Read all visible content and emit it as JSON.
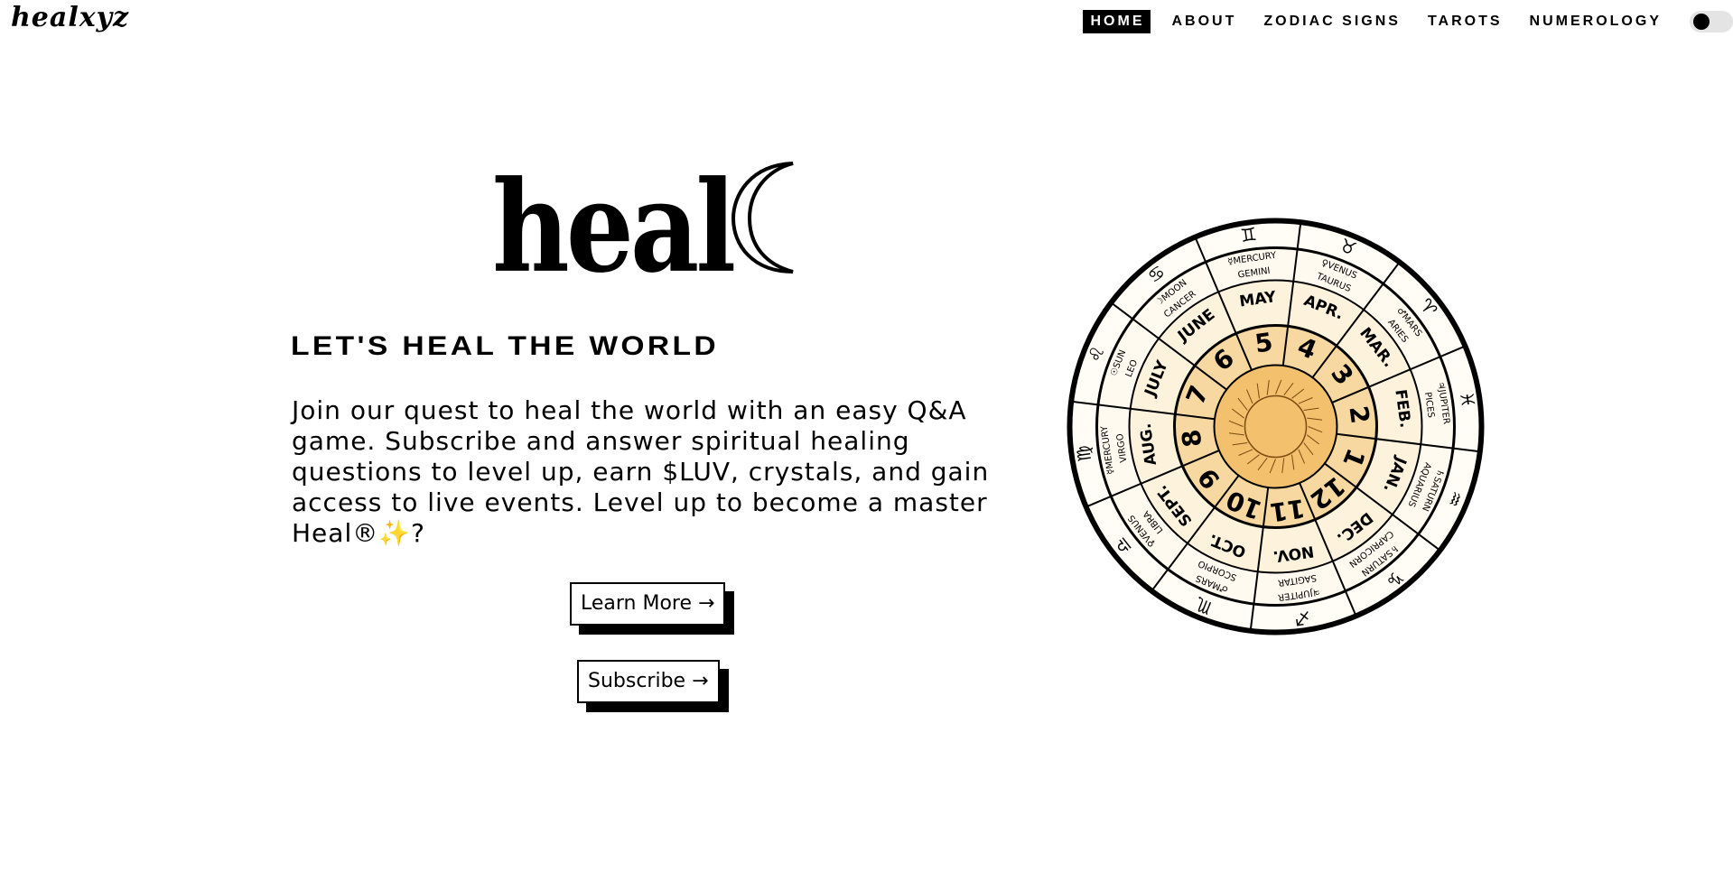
{
  "header": {
    "logo": "healxyz",
    "nav": [
      {
        "label": "HOME",
        "active": true
      },
      {
        "label": "ABOUT",
        "active": false
      },
      {
        "label": "ZODIAC SIGNS",
        "active": false
      },
      {
        "label": "TAROTS",
        "active": false
      },
      {
        "label": "NUMEROLOGY",
        "active": false
      }
    ],
    "theme_toggle": {
      "state": "off"
    }
  },
  "hero": {
    "wordmark": "heal",
    "wordmark_icon": "crescent-moon-icon",
    "tagline": "LET'S HEAL THE WORLD",
    "intro_text": "Join our quest to heal the world with an easy Q&A game. Subscribe and answer spiritual healing questions to level up, earn $LUV, crystals, and gain access to live events. Level up to become a master Heal®",
    "intro_sparkle": "✨",
    "intro_end": "?",
    "buttons": {
      "learn_more": "Learn More →",
      "subscribe": "Subscribe →"
    }
  },
  "zodiac_wheel": {
    "months": [
      "JAN.",
      "FEB.",
      "MAR.",
      "APR.",
      "MAY",
      "JUNE",
      "JULY",
      "AUG.",
      "SEPT.",
      "OCT.",
      "NOV.",
      "DEC."
    ],
    "signs": [
      "AQUARIUS",
      "PICES",
      "ARIES",
      "TAURUS",
      "GEMINI",
      "CANCER",
      "LEO",
      "VIRGO",
      "LIBRA",
      "SCORPIO",
      "SAGITAR",
      "CAPRICORN"
    ],
    "planets": [
      "♄SATURN",
      "♃JUPITER",
      "♂MARS",
      "♀VENUS",
      "☿MERCURY",
      "☽MOON",
      "☉SUN",
      "☿MERCURY",
      "♀VENUS",
      "♂MARS",
      "♃JUPITER",
      "♄SATURN"
    ],
    "symbols": [
      "♒",
      "♓",
      "♈",
      "♉",
      "♊",
      "♋",
      "♌",
      "♍",
      "♎",
      "♏",
      "♐",
      "♑"
    ],
    "numbers": [
      "1",
      "2",
      "3",
      "4",
      "5",
      "6",
      "7",
      "8",
      "9",
      "10",
      "11",
      "12"
    ],
    "colors": {
      "center": "#f3c06e",
      "inner_ring": "#f7d8a0",
      "ink": "#000000"
    }
  }
}
